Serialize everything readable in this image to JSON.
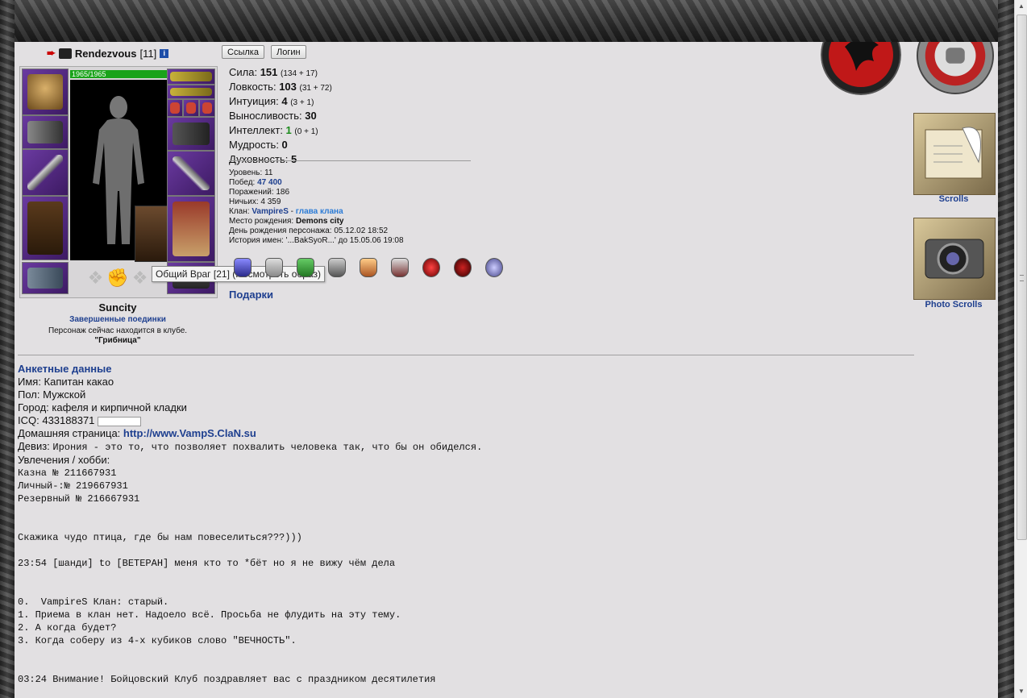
{
  "header": {
    "nick": "Rendezvous",
    "level": "[11]",
    "buttons": {
      "link": "Ссылка",
      "login": "Логин"
    }
  },
  "character": {
    "hp": "1965/1965",
    "emblem_icon": "fist-emblem-icon",
    "tooltip": "Общий Враг [21] (Посмотреть образ)",
    "city": "Suncity",
    "finished_fights": "Завершенные поединки",
    "location_text": "Персонаж сейчас находится в клубе.",
    "location_name": "\"Грибница\""
  },
  "stats": [
    {
      "name": "Сила: ",
      "value": "151",
      "extra": "(134 + 17)"
    },
    {
      "name": "Ловкость: ",
      "value": "103",
      "extra": "(31 + 72)"
    },
    {
      "name": "Интуиция: ",
      "value": "4",
      "extra": "(3 + 1)"
    },
    {
      "name": "Выносливость: ",
      "value": "30",
      "extra": ""
    },
    {
      "name": "Интеллект: ",
      "value": "1",
      "extra": "(0 + 1)"
    },
    {
      "name": "Мудрость: ",
      "value": "0",
      "extra": ""
    },
    {
      "name": "Духовность: ",
      "value": "5",
      "extra": ""
    }
  ],
  "info": {
    "level": "Уровень: 11",
    "wins_label": "Побед: ",
    "wins": "47 400",
    "losses": "Поражений: 186",
    "draws": "Ничьих: 4 359",
    "clan_label": "Клан: ",
    "clan": "VampireS",
    "clan_sep": " - ",
    "clan_role": "глава клана",
    "birthplace_label": "Место рождения: ",
    "birthplace": "Demons city",
    "birthday": "День рождения персонажа: 05.12.02 18:52",
    "name_history": "История имен: '...BakSyoR...' до 15.05.06 19:08"
  },
  "gifts": "Подарки",
  "questionnaire": {
    "title": "Анкетные данные",
    "name": "Имя: Капитан какао",
    "sex": "Пол: Мужской",
    "city": "Город: кафеля и кирпичной кладки",
    "icq": "ICQ: 433188371",
    "homepage_label": "Домашняя страница: ",
    "homepage": "http://www.VampS.ClaN.su",
    "motto_label": "Девиз: ",
    "motto": "Ирония - это то, что позволяет похвалить человека так, что бы он обиделся.",
    "hobby_label": "Увлечения / хобби:",
    "lines": [
      "Казна № 211667931",
      "Личный-:№ 219667931",
      "Резервный № 216667931",
      "",
      "",
      "Скажика чудо птица, где бы нам повеселиться???)))",
      "",
      "23:54 [шанди] to [ВЕТЕРАН] меня кто то *бёт но я не вижу чём дела",
      "",
      "",
      "0.  VampireS Клан: старый.",
      "1. Приема в клан нет. Надоело всё. Просьба не флудить на эту тему.",
      "2. А когда будет?",
      "3. Когда соберу из 4-х кубиков слово \"ВЕЧНОСТЬ\".",
      "",
      "",
      "03:24 Внимание! Бойцовский Клуб поздравляет вас с праздником десятилетия"
    ]
  },
  "right": {
    "scrolls": "Scrolls",
    "photo_scrolls": "Photo Scrolls"
  },
  "colors": {
    "page_bg": "#e2e0e2",
    "link_blue": "#1e3f8f",
    "hp_green": "#1aa31a"
  }
}
